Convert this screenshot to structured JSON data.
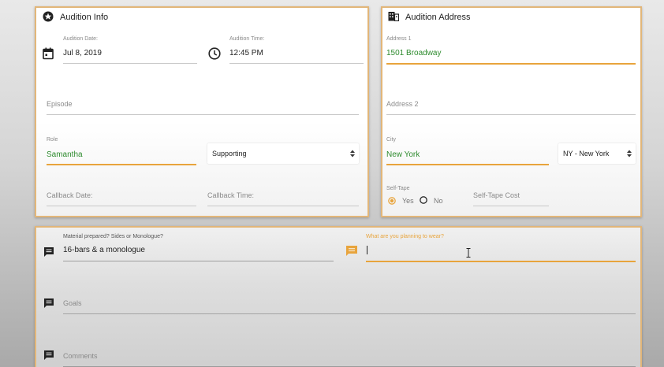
{
  "colors": {
    "accent": "#e8a43c",
    "border": "#e2b679",
    "valid_text": "#2e8b2e"
  },
  "audition_info": {
    "title": "Audition Info",
    "icon": "star-circle-icon",
    "date": {
      "label": "Audition Date:",
      "value": "Jul 8, 2019",
      "icon": "calendar-icon"
    },
    "time": {
      "label": "Audition Time:",
      "value": "12:45 PM",
      "icon": "clock-icon"
    },
    "episode": {
      "placeholder": "Episode"
    },
    "role": {
      "label": "Role",
      "value": "Samantha"
    },
    "role_type": {
      "value": "Supporting"
    },
    "callback_date": {
      "placeholder": "Callback Date:"
    },
    "callback_time": {
      "placeholder": "Callback Time:"
    }
  },
  "audition_address": {
    "title": "Audition Address",
    "icon": "building-icon",
    "address1": {
      "label": "Address 1",
      "value": "1501 Broadway"
    },
    "address2": {
      "placeholder": "Address 2"
    },
    "city": {
      "label": "City",
      "value": "New York"
    },
    "state": {
      "value": "NY - New York"
    },
    "self_tape": {
      "label": "Self-Tape",
      "yes": "Yes",
      "no": "No",
      "selected": "Yes"
    },
    "self_tape_cost": {
      "placeholder": "Self-Tape Cost"
    }
  },
  "notes": {
    "material": {
      "label": "Material prepared? Sides or Monologue?",
      "value": "16-bars & a monologue",
      "icon": "comment-icon"
    },
    "wear": {
      "label": "What are you planning to wear?",
      "value": "",
      "icon": "comment-icon"
    },
    "goals": {
      "placeholder": "Goals",
      "icon": "comment-icon"
    },
    "comments": {
      "placeholder": "Comments",
      "icon": "comment-icon"
    }
  }
}
